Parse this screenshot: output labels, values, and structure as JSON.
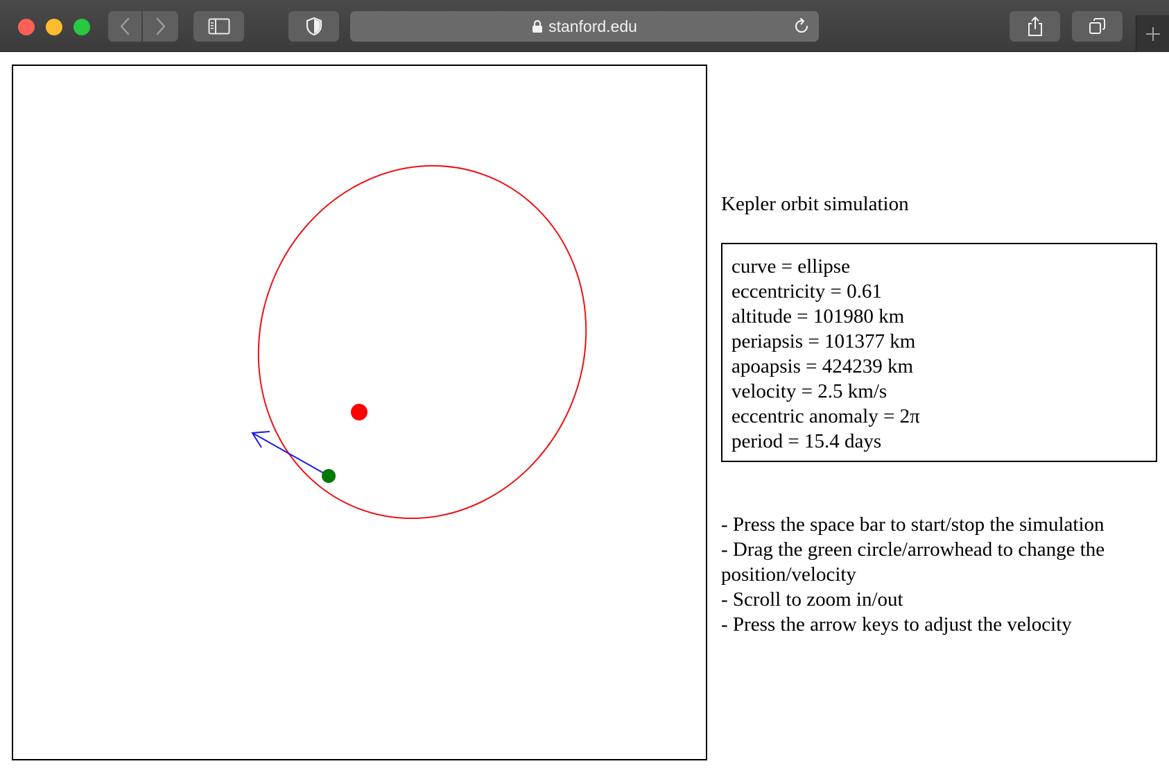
{
  "browser": {
    "url": "stanford.edu",
    "icons": [
      "back-icon",
      "forward-icon",
      "sidebar-icon",
      "shield-icon",
      "lock-icon",
      "reload-icon",
      "share-icon",
      "tabs-icon",
      "plus-icon"
    ]
  },
  "page": {
    "title": "Kepler orbit simulation",
    "info": [
      "curve = ellipse",
      "eccentricity = 0.61",
      "altitude = 101980 km",
      "periapsis = 101377 km",
      "apoapsis = 424239 km",
      "velocity = 2.5 km/s",
      "eccentric anomaly = 2π",
      "period = 15.4 days"
    ],
    "instructions": [
      "- Press the space bar to start/stop the simulation",
      "- Drag the green circle/arrowhead to change the position/velocity",
      "- Scroll to zoom in/out",
      "- Press the arrow keys to adjust the velocity"
    ]
  },
  "colors": {
    "orbit": "#ee1111",
    "central_body": "#ff0000",
    "satellite": "#007700",
    "velocity_arrow": "#1a1aee"
  }
}
